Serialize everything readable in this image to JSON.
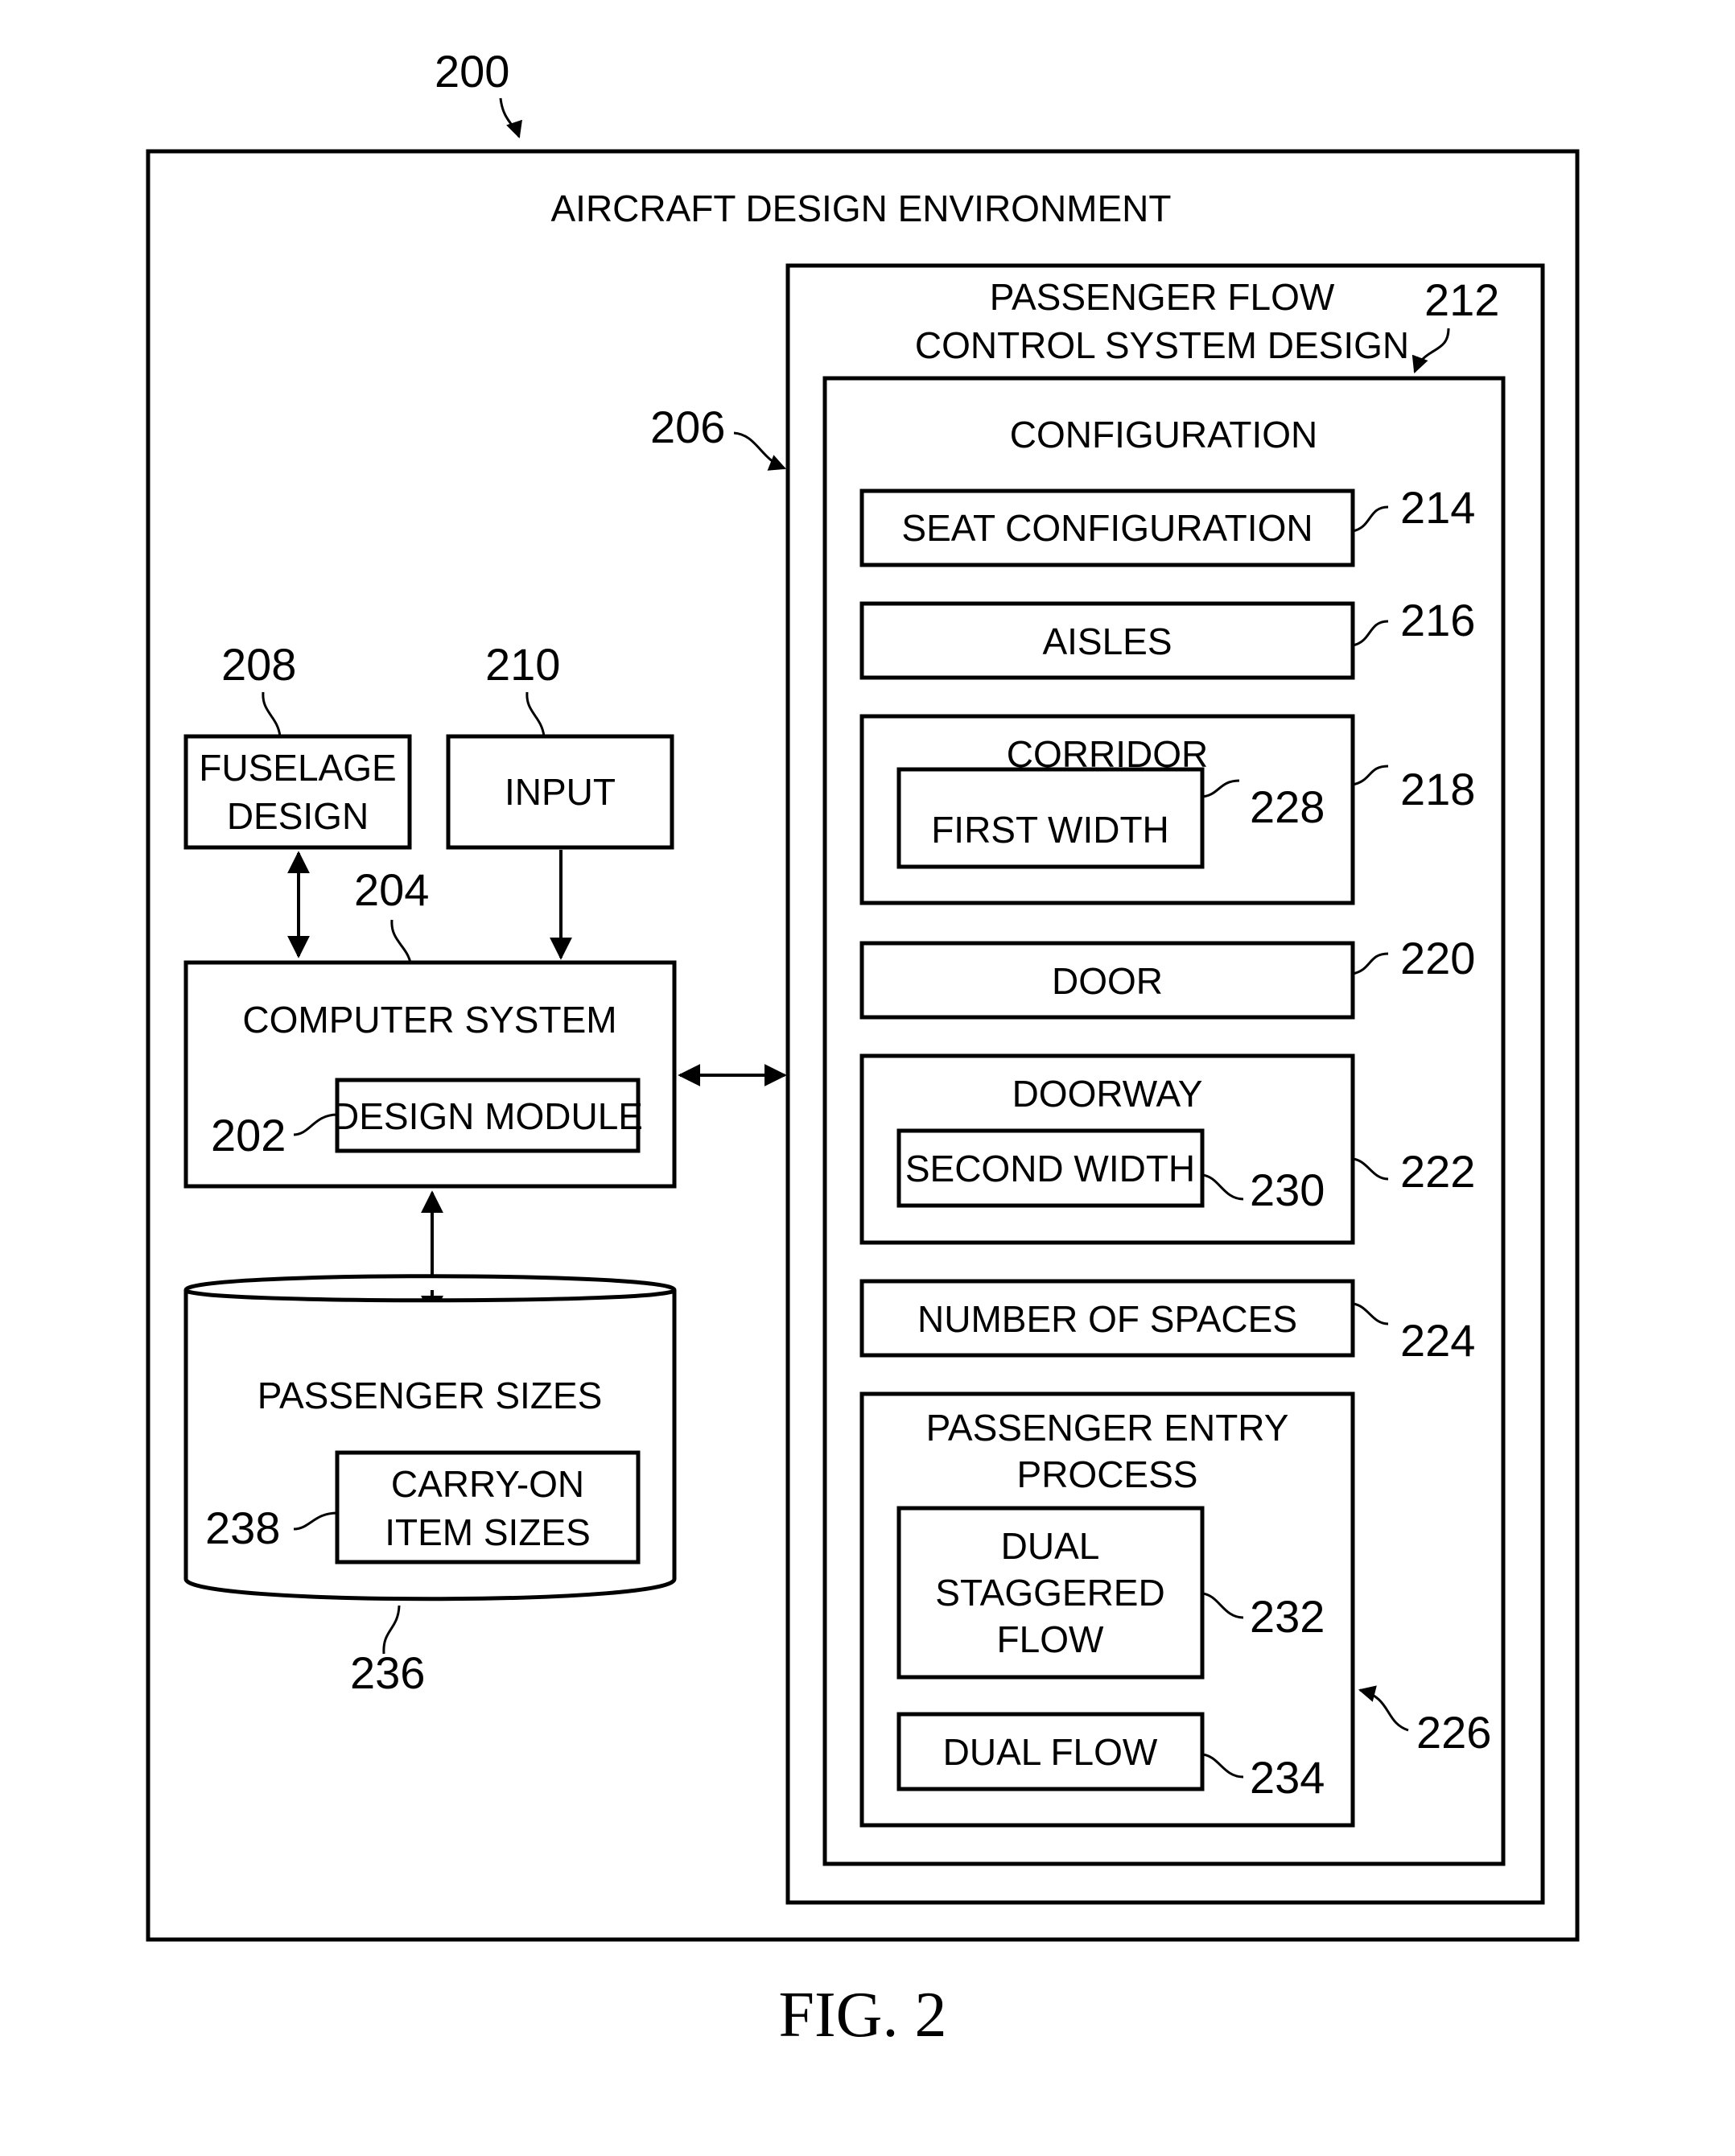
{
  "figure": {
    "caption": "FIG. 2",
    "ref": "200",
    "title": "AIRCRAFT DESIGN ENVIRONMENT"
  },
  "left": {
    "fuselage_design": {
      "ref": "208",
      "line1": "FUSELAGE",
      "line2": "DESIGN"
    },
    "input": {
      "ref": "210",
      "label": "INPUT"
    },
    "computer_system": {
      "ref": "204",
      "label": "COMPUTER SYSTEM"
    },
    "design_module": {
      "ref": "202",
      "label": "DESIGN MODULE"
    },
    "passenger_sizes": {
      "ref": "236",
      "label": "PASSENGER SIZES"
    },
    "carry_on": {
      "ref": "238",
      "line1": "CARRY-ON",
      "line2": "ITEM SIZES"
    }
  },
  "right": {
    "pfcs": {
      "ref": "206",
      "line1": "PASSENGER FLOW",
      "line2": "CONTROL SYSTEM DESIGN"
    },
    "configuration": {
      "ref": "212",
      "label": "CONFIGURATION"
    },
    "seat_configuration": {
      "ref": "214",
      "label": "SEAT CONFIGURATION"
    },
    "aisles": {
      "ref": "216",
      "label": "AISLES"
    },
    "corridor": {
      "ref": "218",
      "label": "CORRIDOR"
    },
    "first_width": {
      "ref": "228",
      "label": "FIRST WIDTH"
    },
    "door": {
      "ref": "220",
      "label": "DOOR"
    },
    "doorway": {
      "ref": "222",
      "label": "DOORWAY"
    },
    "second_width": {
      "ref": "230",
      "label": "SECOND WIDTH"
    },
    "number_of_spaces": {
      "ref": "224",
      "label": "NUMBER OF SPACES"
    },
    "passenger_entry": {
      "ref": "226",
      "line1": "PASSENGER ENTRY",
      "line2": "PROCESS"
    },
    "dual_staggered": {
      "ref": "232",
      "line1": "DUAL",
      "line2": "STAGGERED",
      "line3": "FLOW"
    },
    "dual_flow": {
      "ref": "234",
      "label": "DUAL FLOW"
    }
  }
}
